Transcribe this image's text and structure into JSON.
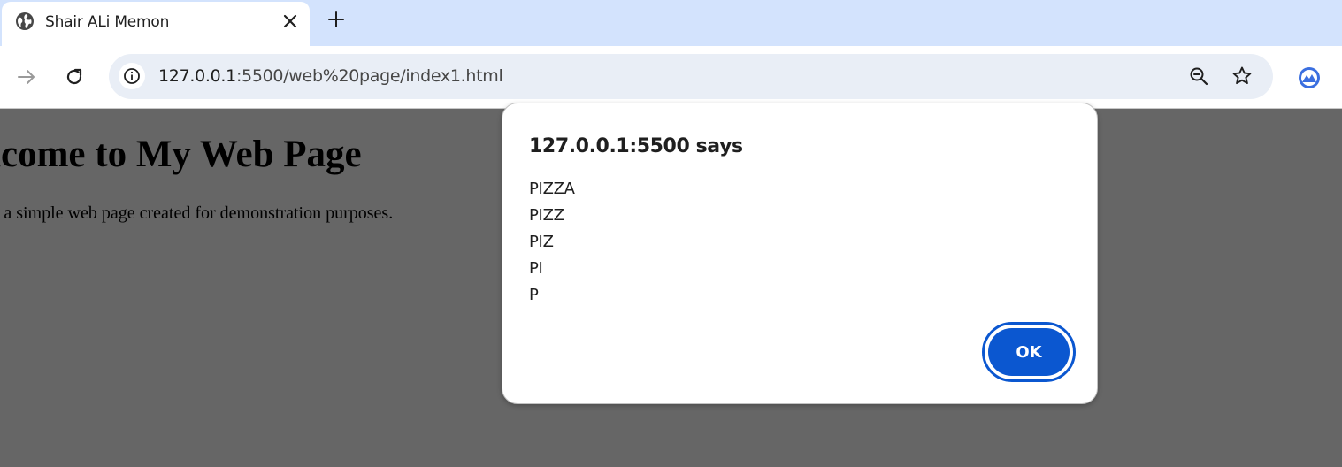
{
  "browser": {
    "tab": {
      "title": "Shair ALi Memon",
      "favicon": "globe-icon"
    },
    "url_host": "127.0.0.1",
    "url_rest": ":5500/web%20page/index1.html",
    "accent_color": "#0b57d0",
    "tabstrip_color": "#d3e3fd"
  },
  "page": {
    "heading": "elcome to My Web Page",
    "paragraph": "is a simple web page created for demonstration purposes."
  },
  "alert": {
    "title": "127.0.0.1:5500 says",
    "lines": [
      "PIZZA",
      "PIZZ",
      "PIZ",
      "PI",
      "P"
    ],
    "ok_label": "OK"
  }
}
